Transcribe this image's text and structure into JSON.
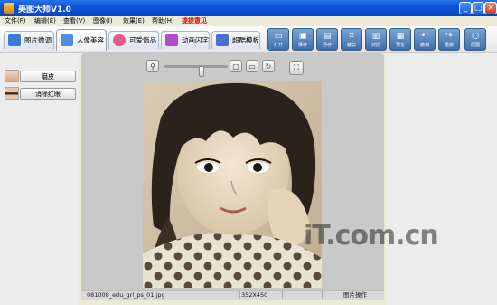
{
  "window": {
    "title": "美图大师V1.0",
    "controls": [
      "_",
      "□",
      "×"
    ]
  },
  "menu": [
    {
      "label": "文件(F)"
    },
    {
      "label": "编辑(E)"
    },
    {
      "label": "查看(V)"
    },
    {
      "label": "图像(I)"
    },
    {
      "label": "效果(E)"
    },
    {
      "label": "帮助(H)"
    },
    {
      "label": "提提意见"
    }
  ],
  "tabs": [
    {
      "label": "图片微调",
      "icon": "sliders-icon",
      "color": "#3a7bd5"
    },
    {
      "label": "人像美容",
      "icon": "portrait-icon",
      "color": "#4b8fe0"
    },
    {
      "label": "可爱饰品",
      "icon": "flower-icon",
      "color": "#e05a8a"
    },
    {
      "label": "动画闪字",
      "icon": "animation-icon",
      "color": "#b04bd0"
    },
    {
      "label": "超酷模板",
      "icon": "template-icon",
      "color": "#4a6fd0"
    }
  ],
  "toolbar_buttons": [
    {
      "label": "打开",
      "icon": "open-icon",
      "glyph": "📂"
    },
    {
      "label": "保存",
      "icon": "save-icon",
      "glyph": "▣"
    },
    {
      "label": "另存",
      "icon": "save-as-icon",
      "glyph": "▤"
    },
    {
      "label": "裁剪",
      "icon": "crop-icon",
      "glyph": "⌗"
    },
    {
      "label": "对比",
      "icon": "compare-icon",
      "glyph": "▥"
    },
    {
      "label": "预览",
      "icon": "preview-icon",
      "glyph": "▦"
    },
    {
      "label": "撤销",
      "icon": "undo-icon",
      "glyph": "↶"
    },
    {
      "label": "重做",
      "icon": "redo-icon",
      "glyph": "↷"
    },
    {
      "label": "原图",
      "icon": "original-icon",
      "glyph": "○"
    }
  ],
  "left_panel": {
    "buttons": [
      {
        "label": "磨皮"
      },
      {
        "label": "消除红眼"
      }
    ]
  },
  "zoom": {
    "level": 0.6
  },
  "status": {
    "filename": "081008_edu_grl_ps_01.jpg",
    "dimensions": "352X450",
    "section": "图片操作"
  },
  "watermark": "iT.com.cn"
}
